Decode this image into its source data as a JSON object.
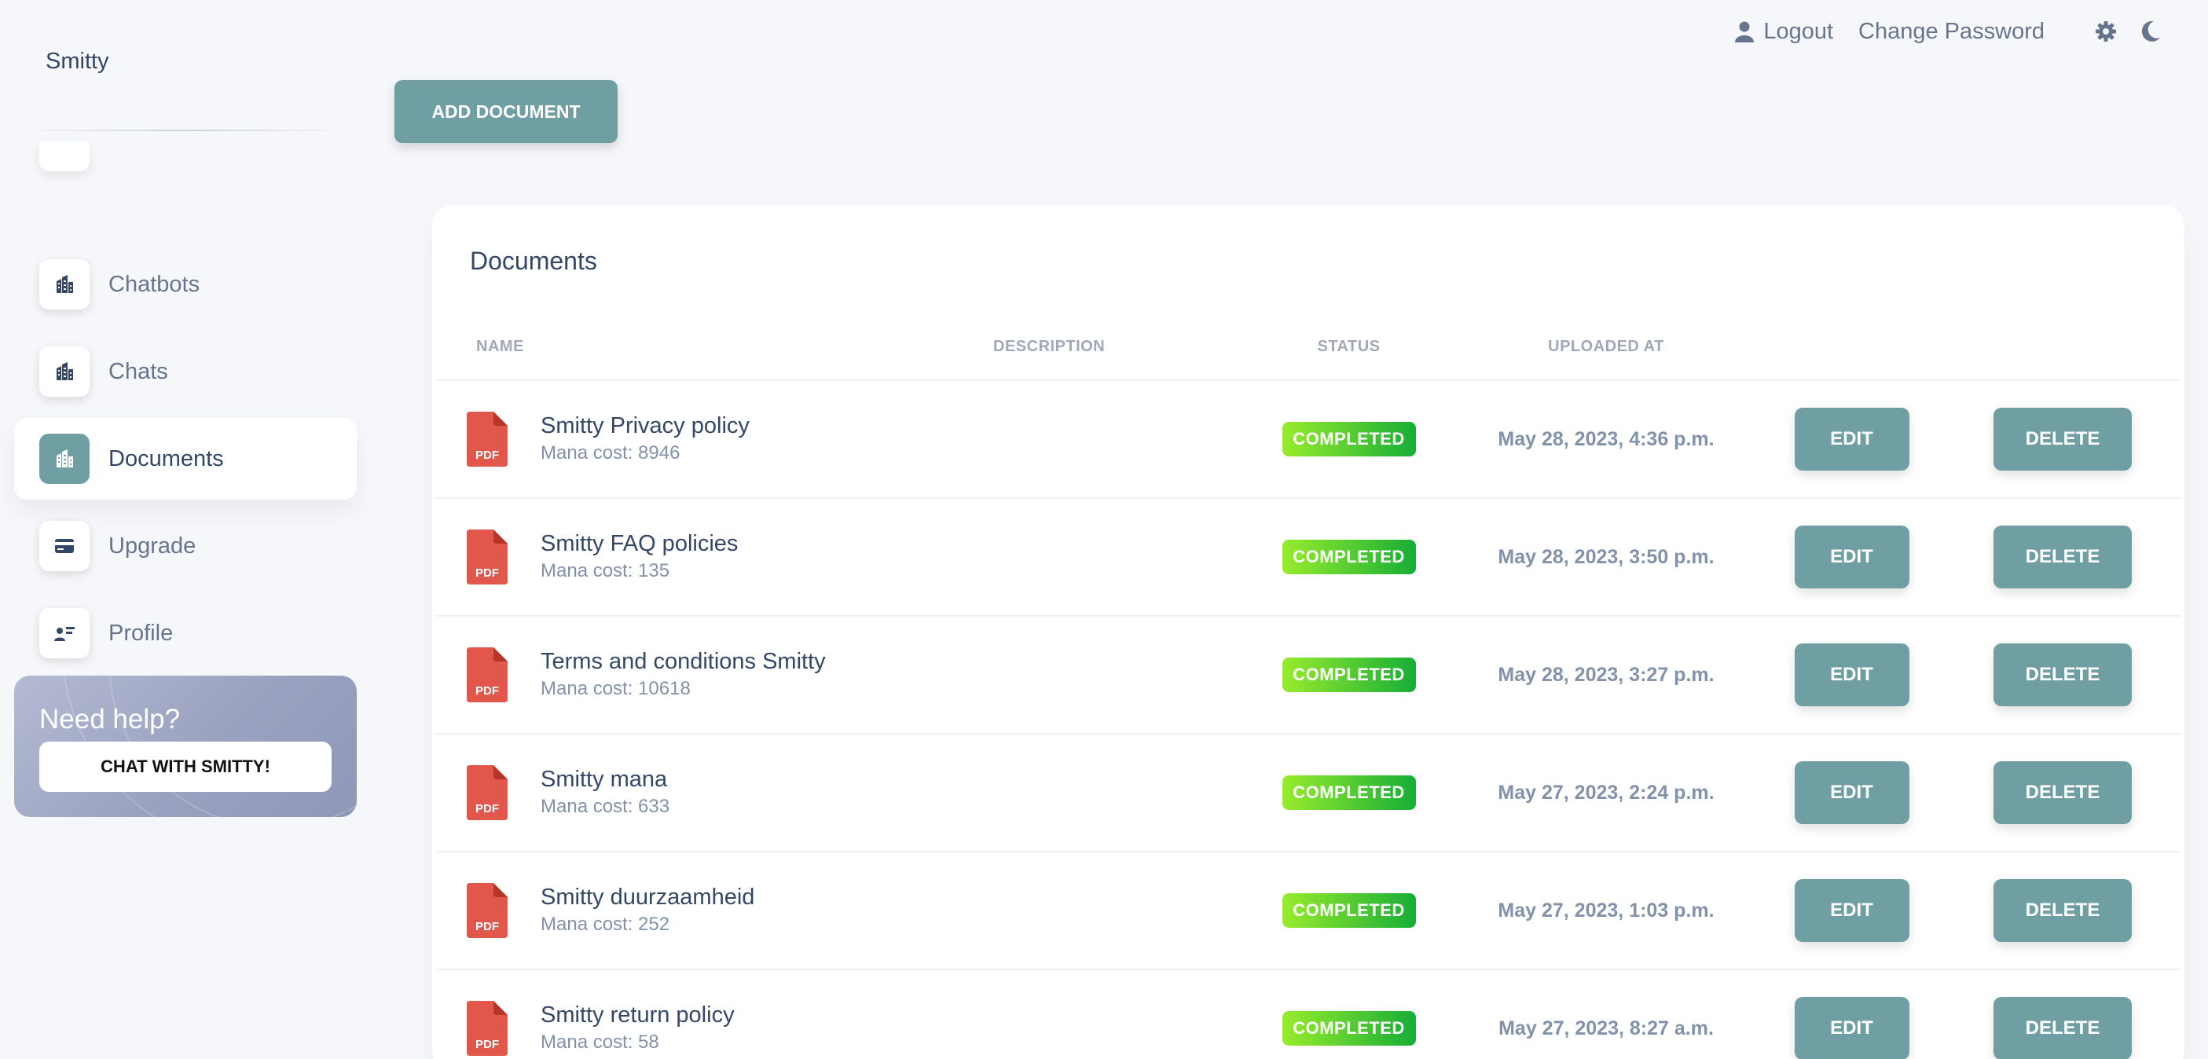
{
  "app": {
    "brand": "Smitty"
  },
  "topnav": {
    "logout_label": "Logout",
    "change_password_label": "Change Password"
  },
  "sidebar": {
    "items": [
      {
        "label": "Chatbots",
        "icon": "building-icon",
        "active": false
      },
      {
        "label": "Chats",
        "icon": "building-icon",
        "active": false
      },
      {
        "label": "Documents",
        "icon": "building-icon",
        "active": true
      },
      {
        "label": "Upgrade",
        "icon": "credit-card-icon",
        "active": false
      },
      {
        "label": "Profile",
        "icon": "user-card-icon",
        "active": false
      }
    ],
    "help": {
      "title": "Need help?",
      "button_label": "CHAT WITH SMITTY!"
    }
  },
  "main": {
    "add_document_label": "ADD DOCUMENT",
    "card_title": "Documents",
    "columns": {
      "name": "NAME",
      "description": "DESCRIPTION",
      "status": "STATUS",
      "uploaded_at": "UPLOADED AT"
    },
    "rows": [
      {
        "file_type": "PDF",
        "title": "Smitty Privacy policy",
        "subtitle": "Mana cost: 8946",
        "description": "",
        "status": "COMPLETED",
        "uploaded_at": "May 28, 2023, 4:36 p.m.",
        "edit_label": "EDIT",
        "delete_label": "DELETE"
      },
      {
        "file_type": "PDF",
        "title": "Smitty FAQ policies",
        "subtitle": "Mana cost: 135",
        "description": "",
        "status": "COMPLETED",
        "uploaded_at": "May 28, 2023, 3:50 p.m.",
        "edit_label": "EDIT",
        "delete_label": "DELETE"
      },
      {
        "file_type": "PDF",
        "title": "Terms and conditions Smitty",
        "subtitle": "Mana cost: 10618",
        "description": "",
        "status": "COMPLETED",
        "uploaded_at": "May 28, 2023, 3:27 p.m.",
        "edit_label": "EDIT",
        "delete_label": "DELETE"
      },
      {
        "file_type": "PDF",
        "title": "Smitty mana",
        "subtitle": "Mana cost: 633",
        "description": "",
        "status": "COMPLETED",
        "uploaded_at": "May 27, 2023, 2:24 p.m.",
        "edit_label": "EDIT",
        "delete_label": "DELETE"
      },
      {
        "file_type": "PDF",
        "title": "Smitty duurzaamheid",
        "subtitle": "Mana cost: 252",
        "description": "",
        "status": "COMPLETED",
        "uploaded_at": "May 27, 2023, 1:03 p.m.",
        "edit_label": "EDIT",
        "delete_label": "DELETE"
      },
      {
        "file_type": "PDF",
        "title": "Smitty return policy",
        "subtitle": "Mana cost: 58",
        "description": "",
        "status": "COMPLETED",
        "uploaded_at": "May 27, 2023, 8:27 a.m.",
        "edit_label": "EDIT",
        "delete_label": "DELETE"
      }
    ]
  },
  "colors": {
    "accent": "#6f9fa3",
    "badge_start": "#98ec2d",
    "badge_end": "#17ad37",
    "pdf_red": "#e2574c",
    "text_primary": "#344767",
    "text_secondary": "#8392ab"
  }
}
